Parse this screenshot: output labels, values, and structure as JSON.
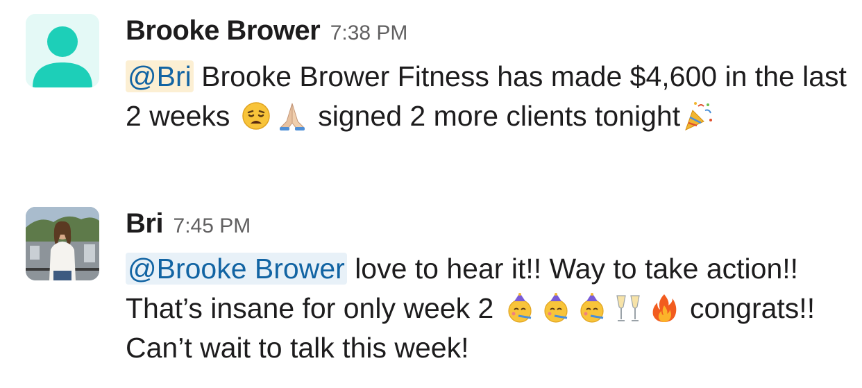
{
  "messages": [
    {
      "sender": "Brooke Brower",
      "time": "7:38 PM",
      "avatar": "default-user-avatar",
      "mention": "@Bri",
      "text_1": " Brooke Brower Fitness has made $4,600 in the last 2 weeks ",
      "text_2": " signed 2 more clients tonight",
      "emojis": [
        "weary-face-emoji",
        "folded-hands-emoji",
        "party-popper-emoji"
      ]
    },
    {
      "sender": "Bri",
      "time": "7:45 PM",
      "avatar": "bri-photo-avatar",
      "mention": "@Brooke Brower",
      "text_1": " love to hear it!! Way to take action!! That’s insane for only week 2 ",
      "text_2": " congrats!! Can’t wait to talk this week!",
      "emojis": [
        "partying-face-emoji",
        "partying-face-emoji",
        "partying-face-emoji",
        "champagne-glasses-emoji",
        "fire-emoji"
      ]
    }
  ],
  "colors": {
    "mention_text": "#1264a3",
    "mention_bg_1": "#fcefd3",
    "mention_bg_2": "#e8f1f8",
    "default_avatar": "#1dcfb8"
  }
}
